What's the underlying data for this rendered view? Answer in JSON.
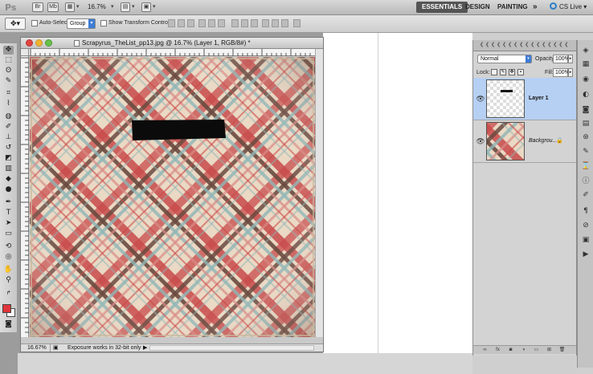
{
  "app": {
    "logo": "Ps",
    "zoom": "16.7%",
    "workspaces": [
      "ESSENTIALS",
      "DESIGN",
      "PAINTING"
    ],
    "more": "»",
    "cs_live": "CS Live",
    "icons": [
      "bridge-icon",
      "minibridge-icon",
      "view-extras-icon",
      "arrange-icon",
      "screen-mode-icon"
    ]
  },
  "options": {
    "auto_select_label": "Auto-Select:",
    "auto_select_checked": false,
    "auto_select_value": "Group",
    "show_transform_label": "Show Transform Controls",
    "show_transform_checked": false
  },
  "document": {
    "title": "Scrapyrus_TheList_pp13.jpg @ 16.7% (Layer 1, RGB/8#) *",
    "zoom": "16.67%",
    "status": "Exposure works in 32-bit only",
    "status_arrow": "▶"
  },
  "toolbox": {
    "tools": [
      "move-tool",
      "marquee-tool",
      "lasso-tool",
      "quick-select-tool",
      "crop-tool",
      "eyedropper-tool",
      "spot-heal-tool",
      "brush-tool",
      "stamp-tool",
      "history-brush-tool",
      "eraser-tool",
      "gradient-tool",
      "blur-tool",
      "dodge-tool",
      "pen-tool",
      "type-tool",
      "path-select-tool",
      "shape-tool",
      "3d-rotate-tool",
      "3d-orbit-tool",
      "hand-tool",
      "zoom-tool"
    ],
    "foreground_color": "#e0353a",
    "background_color": "#ffffff"
  },
  "layers": {
    "blend_mode": "Normal",
    "opacity_label": "Opacity:",
    "opacity": "100%",
    "lock_label": "Lock:",
    "fill_label": "Fill:",
    "fill": "100%",
    "items": [
      {
        "name": "Layer 1",
        "selected": true
      },
      {
        "name": "Backgrou...",
        "selected": false,
        "locked": true
      }
    ]
  },
  "colors": {
    "selection": "#b6d0f3",
    "accent": "#3d7cd6",
    "plaid_red": "#c64848",
    "plaid_brown": "#6b4a3f",
    "plaid_blue": "#8fb5b7",
    "paper": "#e8dcc7"
  }
}
